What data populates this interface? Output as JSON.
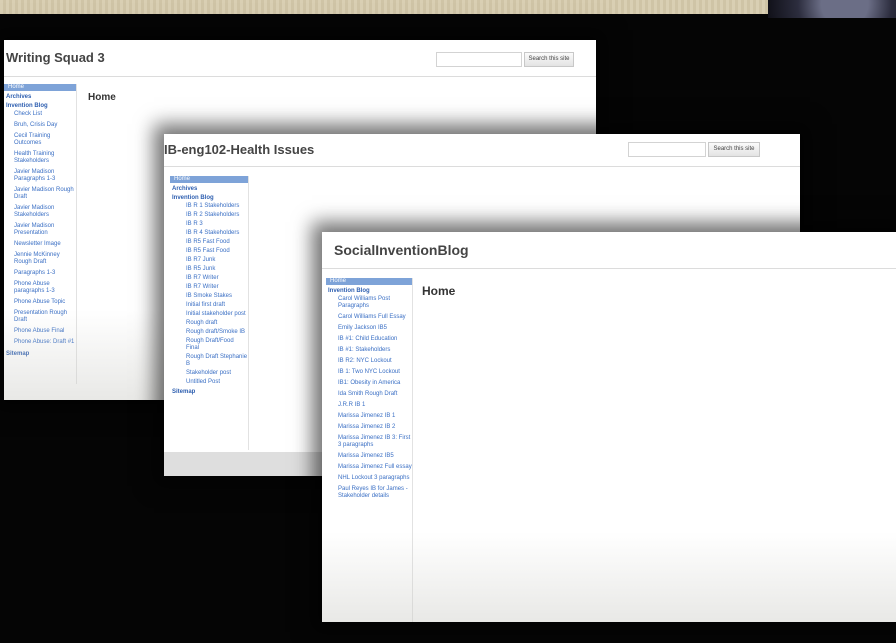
{
  "window_1": {
    "site_title": "Writing Squad 3",
    "search_button": "Search this site",
    "nav": {
      "home": "Home",
      "archives": "Archives",
      "section": "Invention Blog",
      "items": [
        "Check List",
        "Bruh, Crisis Day",
        "Cecil Training Outcomes",
        "Health Training Stakeholders",
        "Javier Madison Paragraphs 1-3",
        "Javier Madison Rough Draft",
        "Javier Madison Stakeholders",
        "Javier Madison Presentation",
        "Newsletter Image",
        "Jennie McKinney Rough Draft",
        "Paragraphs 1-3",
        "Phone Abuse paragraphs 1-3",
        "Phone Abuse Topic",
        "Presentation Rough Draft",
        "Phone Abuse Final",
        "Phone Abuse: Draft #1"
      ],
      "sitemap": "Sitemap"
    },
    "page_heading": "Home"
  },
  "window_2": {
    "site_title": "IB-eng102-Health Issues",
    "search_button": "Search this site",
    "nav": {
      "home": "Home",
      "archives": "Archives",
      "section": "Invention Blog",
      "items": [
        "IB R 1 Stakeholders",
        "IB R 2 Stakeholders",
        "IB R 3",
        "IB R 4 Stakeholders",
        "IB R5 Fast Food",
        "IB R5 Fast Food",
        "IB R7 Junk",
        "IB R5 Junk",
        "IB R7 Writer",
        "IB R7 Writer",
        "IB Smoke Stakes",
        "Initial first draft",
        "Initial stakeholder post",
        "Rough draft",
        "Rough draft/Smoke IB",
        "Rough Draft/Food Final",
        "Rough Draft Stephanie B",
        "Stakeholder post",
        "Untitled Post"
      ],
      "sitemap": "Sitemap"
    }
  },
  "window_3": {
    "site_title": "SocialInventionBlog",
    "nav": {
      "home": "Home",
      "section": "Invention Blog",
      "items": [
        "Carol Williams Post Paragraphs",
        "Carol Williams Full Essay",
        "Emily Jackson IB5",
        "IB #1: Child Education",
        "IB #1: Stakeholders",
        "IB R2: NYC Lockout",
        "IB 1: Two NYC Lockout",
        "IB1: Obesity in America",
        "Ida Smith Rough Draft",
        "J.R.R IB 1",
        "Marissa Jimenez IB 1",
        "Marissa Jimenez IB 2",
        "Marissa Jimenez IB 3: First 3 paragraphs",
        "Marissa Jimenez IB5",
        "Marissa Jimenez Full essay",
        "NHL Lockout 3 paragraphs",
        "Paul Reyes IB for James - Stakeholder details"
      ]
    },
    "page_heading": "Home"
  },
  "colors": {
    "background": "#050505",
    "nav_highlight": "#7ea3d8",
    "link": "#3a6fc4"
  }
}
